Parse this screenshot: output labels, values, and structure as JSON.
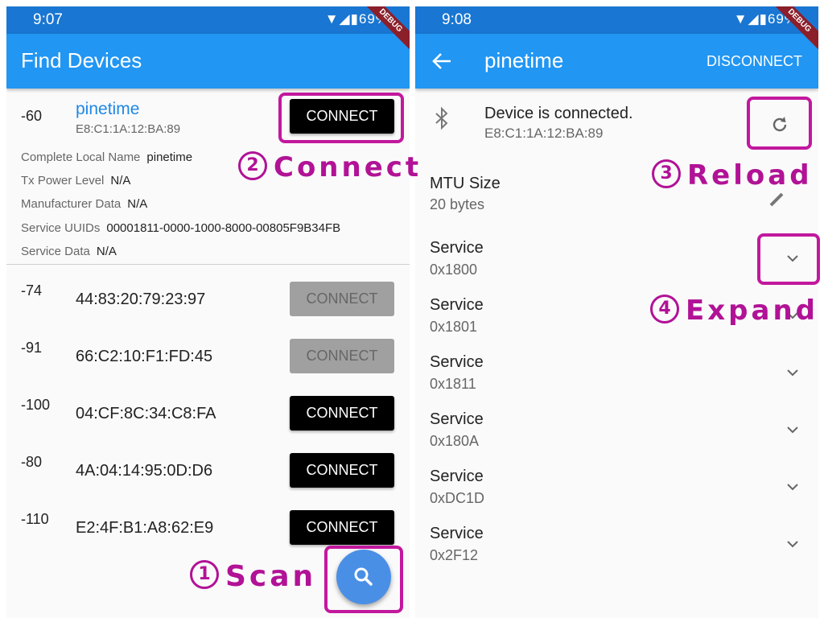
{
  "left": {
    "status": {
      "time": "9:07",
      "battery": "69%"
    },
    "debug": "DEBUG",
    "title": "Find Devices",
    "selected": {
      "rssi": "-60",
      "name": "pinetime",
      "mac": "E8:C1:1A:12:BA:89",
      "connect": "CONNECT",
      "adv": [
        {
          "label": "Complete Local Name",
          "value": "pinetime"
        },
        {
          "label": "Tx Power Level",
          "value": "N/A"
        },
        {
          "label": "Manufacturer Data",
          "value": "N/A"
        },
        {
          "label": "Service UUIDs",
          "value": "00001811-0000-1000-8000-00805F9B34FB"
        },
        {
          "label": "Service Data",
          "value": "N/A"
        }
      ]
    },
    "devices": [
      {
        "rssi": "-74",
        "mac": "44:83:20:79:23:97",
        "connect": "CONNECT",
        "enabled": false
      },
      {
        "rssi": "-91",
        "mac": "66:C2:10:F1:FD:45",
        "connect": "CONNECT",
        "enabled": false
      },
      {
        "rssi": "-100",
        "mac": "04:CF:8C:34:C8:FA",
        "connect": "CONNECT",
        "enabled": true
      },
      {
        "rssi": "-80",
        "mac": "4A:04:14:95:0D:D6",
        "connect": "CONNECT",
        "enabled": true
      },
      {
        "rssi": "-110",
        "mac": "E2:4F:B1:A8:62:E9",
        "connect": "CONNECT",
        "enabled": true
      }
    ],
    "fab_icon": "search-icon"
  },
  "right": {
    "status": {
      "time": "9:08",
      "battery": "69%"
    },
    "debug": "DEBUG",
    "title": "pinetime",
    "disconnect": "DISCONNECT",
    "connection": {
      "status": "Device is connected.",
      "mac": "E8:C1:1A:12:BA:89"
    },
    "mtu": {
      "label": "MTU Size",
      "value": "20 bytes"
    },
    "services": [
      {
        "title": "Service",
        "uuid": "0x1800"
      },
      {
        "title": "Service",
        "uuid": "0x1801"
      },
      {
        "title": "Service",
        "uuid": "0x1811"
      },
      {
        "title": "Service",
        "uuid": "0x180A"
      },
      {
        "title": "Service",
        "uuid": "0xDC1D"
      },
      {
        "title": "Service",
        "uuid": "0x2F12"
      }
    ]
  },
  "annotations": {
    "scan": {
      "num": "1",
      "text": "Scan"
    },
    "connect": {
      "num": "2",
      "text": "Connect"
    },
    "reload": {
      "num": "3",
      "text": "Reload"
    },
    "expand": {
      "num": "4",
      "text": "Expand"
    }
  },
  "colors": {
    "appbar": "#2196f3",
    "statusbar": "#1976d2",
    "link": "#1e88e5",
    "annotation": "#b11296"
  }
}
